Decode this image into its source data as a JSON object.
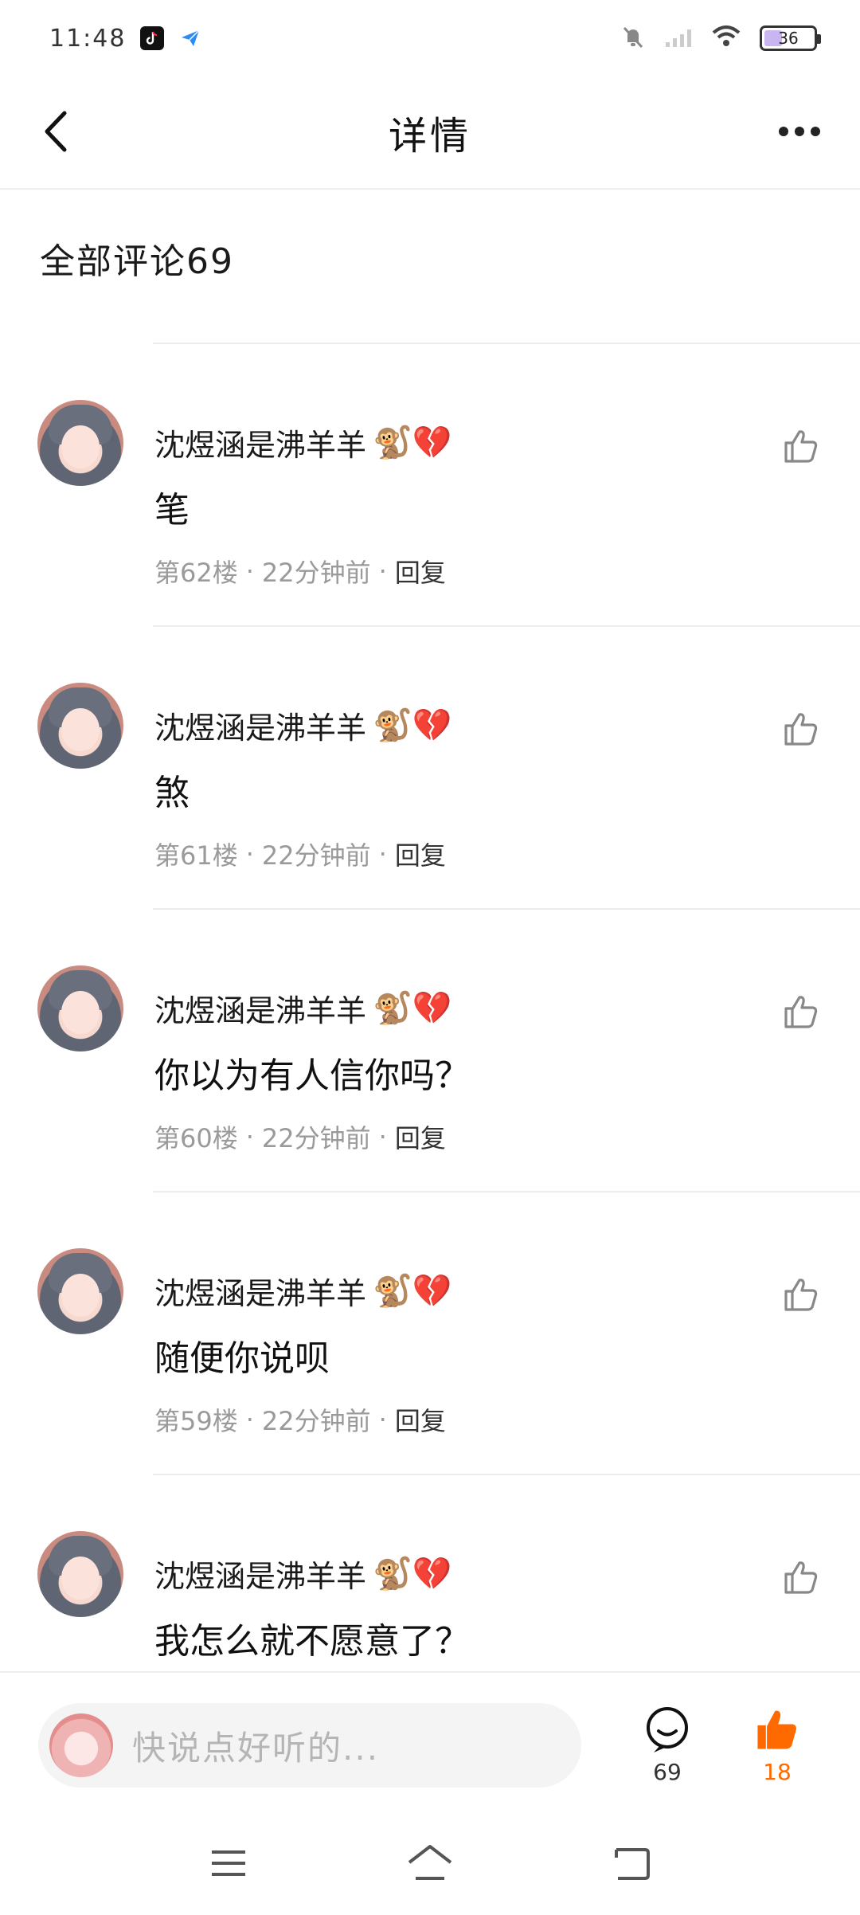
{
  "status_bar": {
    "time": "11:48",
    "battery": "36"
  },
  "nav": {
    "title": "详情"
  },
  "section": {
    "title": "全部评论69"
  },
  "comments": [
    {
      "user": "沈煜涵是沸羊羊",
      "emoji": "🐒💔",
      "text": "笔",
      "floor": "第62楼",
      "time": "22分钟前",
      "reply": "回复"
    },
    {
      "user": "沈煜涵是沸羊羊",
      "emoji": "🐒💔",
      "text": "煞",
      "floor": "第61楼",
      "time": "22分钟前",
      "reply": "回复"
    },
    {
      "user": "沈煜涵是沸羊羊",
      "emoji": "🐒💔",
      "text": "你以为有人信你吗？",
      "floor": "第60楼",
      "time": "22分钟前",
      "reply": "回复"
    },
    {
      "user": "沈煜涵是沸羊羊",
      "emoji": "🐒💔",
      "text": "随便你说呗",
      "floor": "第59楼",
      "time": "22分钟前",
      "reply": "回复"
    },
    {
      "user": "沈煜涵是沸羊羊",
      "emoji": "🐒💔",
      "text": "我怎么就不愿意了？",
      "floor": "",
      "time": "",
      "reply": ""
    }
  ],
  "bottom_bar": {
    "placeholder": "快说点好听的...",
    "comment_count": "69",
    "like_count": "18"
  },
  "colors": {
    "accent": "#ff6a00",
    "meta_text": "#9a9a9a",
    "divider": "#ececec"
  }
}
